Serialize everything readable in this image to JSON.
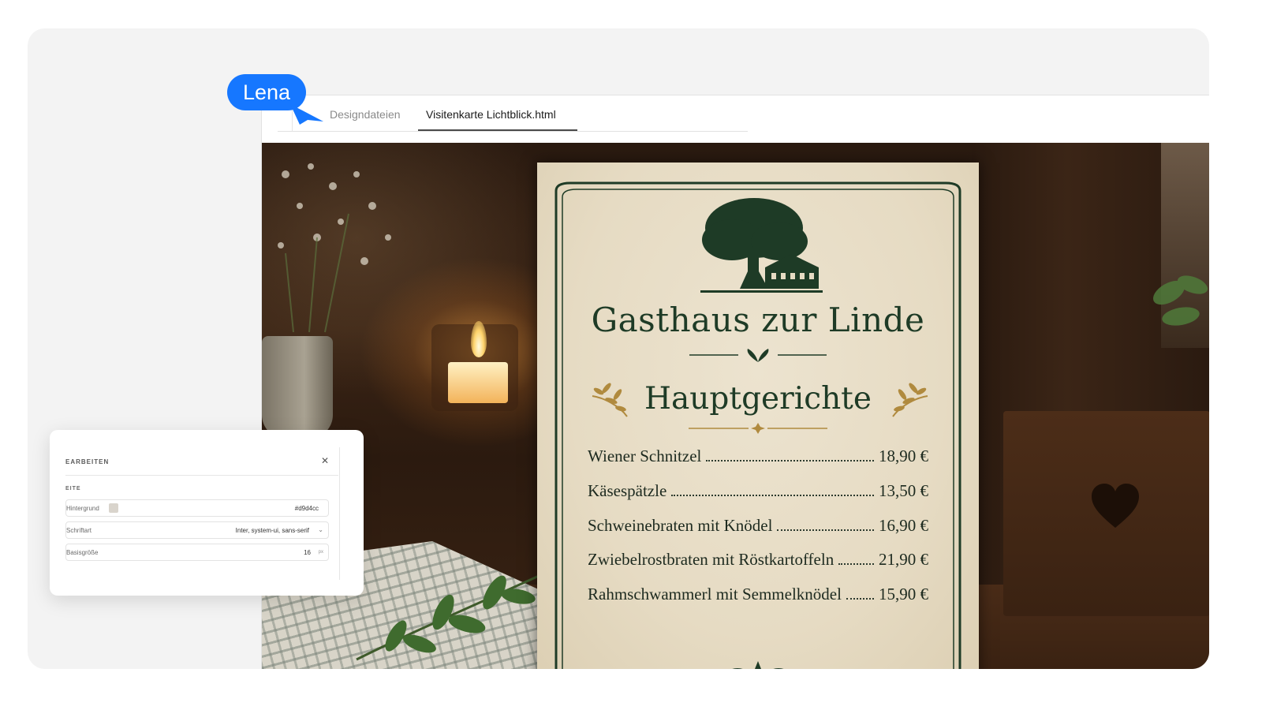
{
  "collaborator": {
    "name": "Lena",
    "color": "#1677ff"
  },
  "editor": {
    "tabs": [
      {
        "label": "Designdateien",
        "active": false
      },
      {
        "label": "Visitenkarte Lichtblick.html",
        "active": true
      }
    ]
  },
  "canvas_image": {
    "menu": {
      "restaurant_name": "Gasthaus zur Linde",
      "section_title": "Hauptgerichte",
      "dishes": [
        {
          "name": "Wiener Schnitzel",
          "price": "18,90 €"
        },
        {
          "name": "Käsespätzle",
          "price": "13,50 €"
        },
        {
          "name": "Schweinebraten mit Knödel",
          "price": "16,90 €"
        },
        {
          "name": "Zwiebelrostbraten mit Röstkartoffeln",
          "price": "21,90 €"
        },
        {
          "name": "Rahmschwammerl mit Semmelknödel",
          "price": "15,90 €"
        }
      ],
      "colors": {
        "ink": "#1e3b26",
        "gold": "#b08a3e",
        "paper": "#e6dbc3"
      }
    }
  },
  "properties_panel": {
    "title": "EARBEITEN",
    "close_icon": "close-icon",
    "section": "EITE",
    "rows": {
      "background": {
        "label": "Hintergrund",
        "value": "#d9d4cc",
        "swatch_color": "#d9d4cc"
      },
      "font": {
        "label": "Schriftart",
        "value": "Inter, system-ui, sans-serif"
      },
      "base_size": {
        "label": "Basisgröße",
        "value": "16",
        "unit": "px"
      }
    }
  }
}
